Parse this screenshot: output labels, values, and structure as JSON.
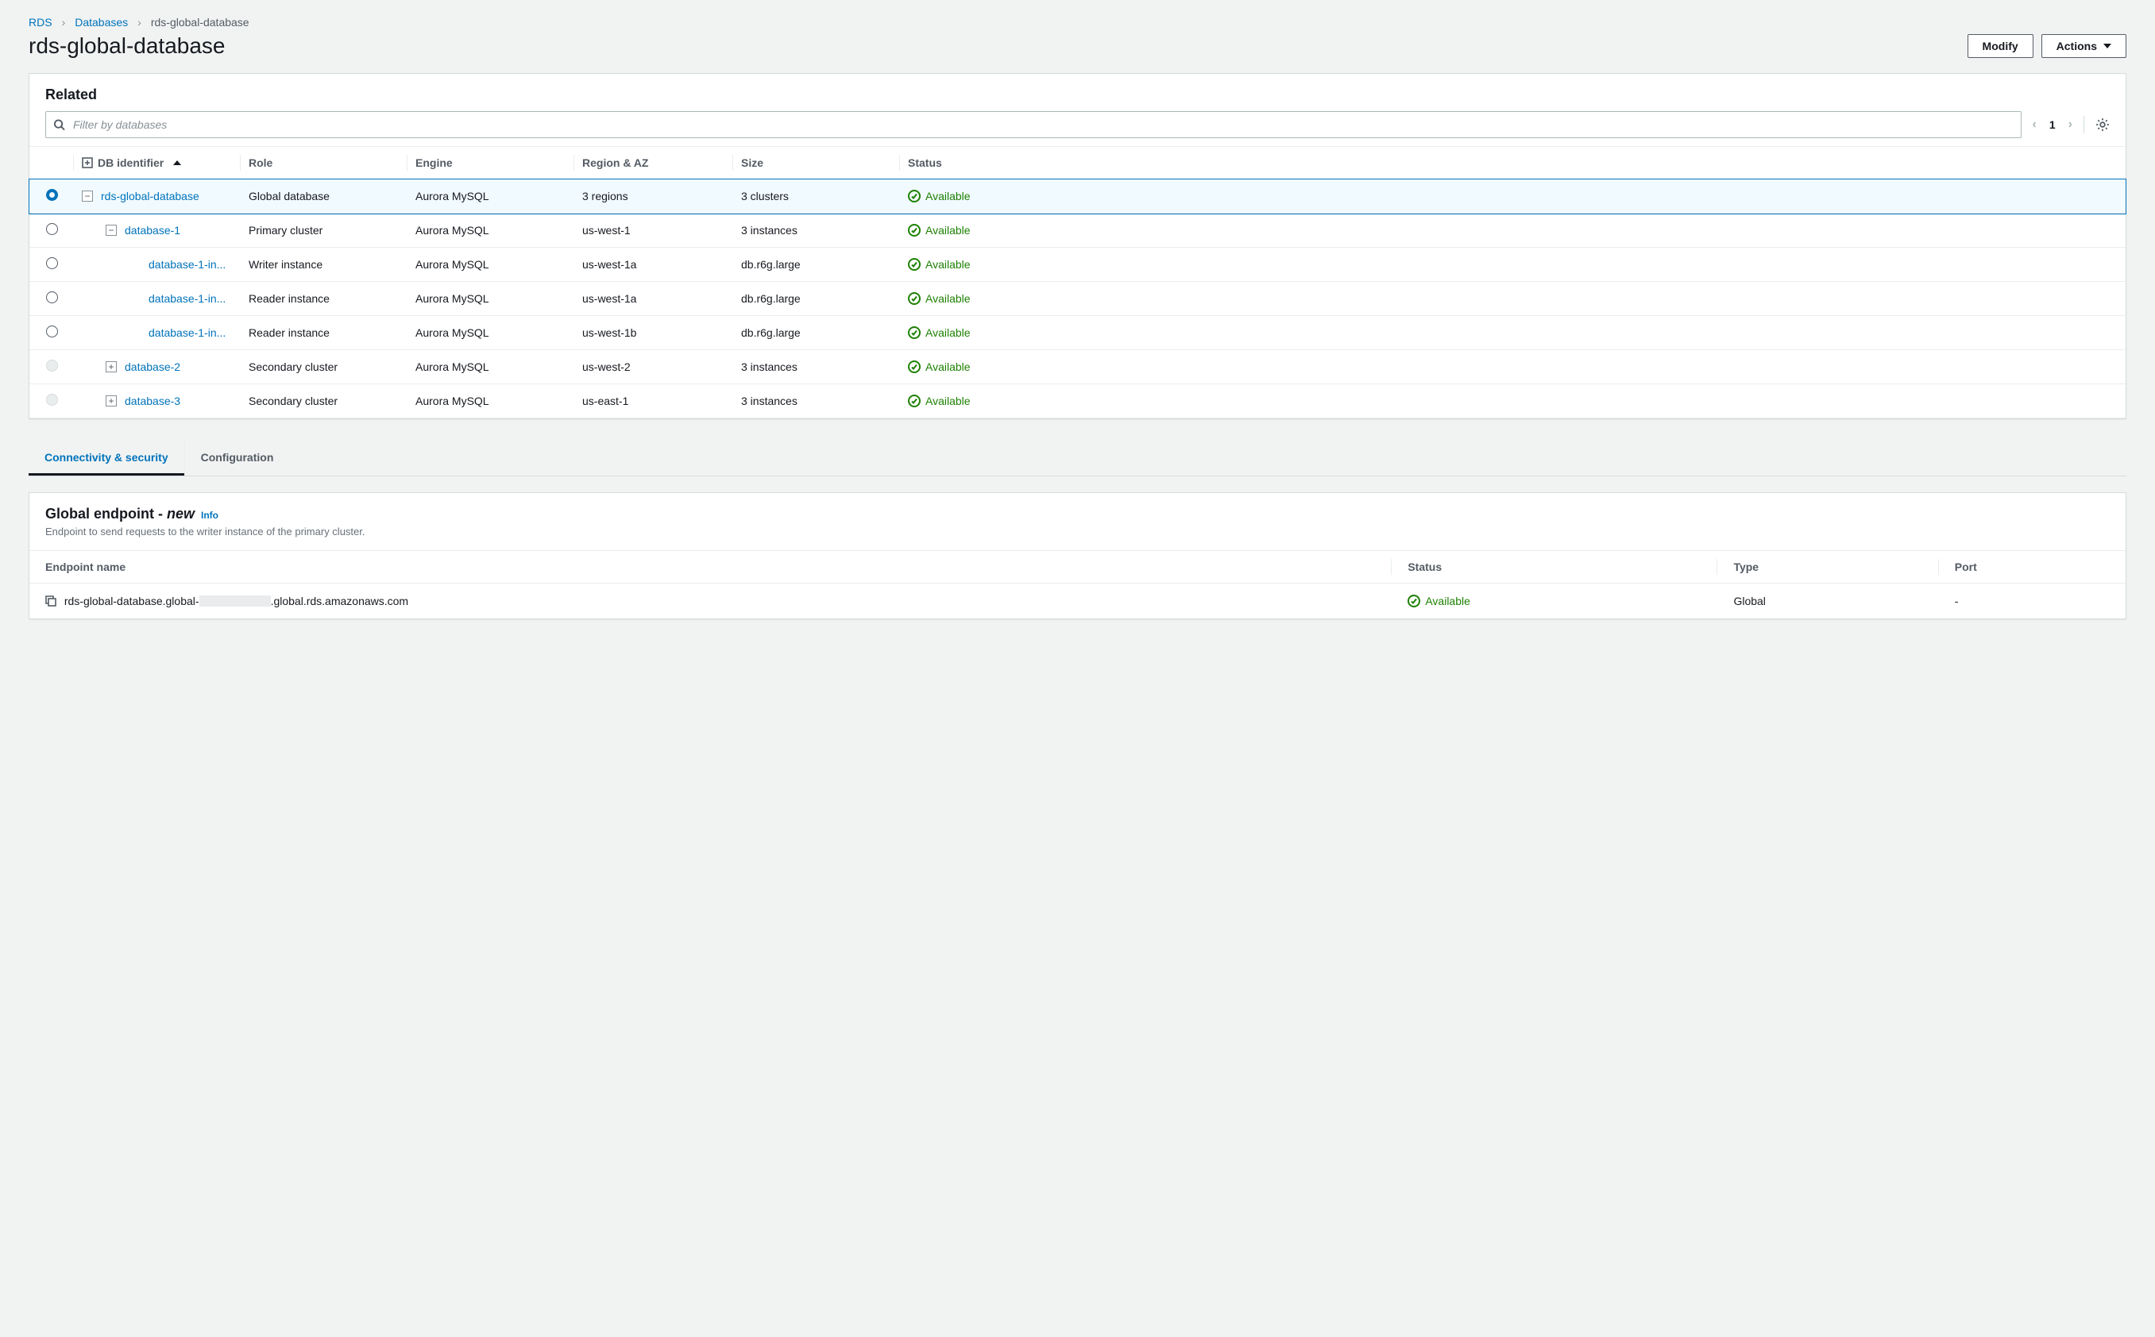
{
  "breadcrumbs": {
    "root": "RDS",
    "level1": "Databases",
    "current": "rds-global-database"
  },
  "page": {
    "title": "rds-global-database",
    "modify_label": "Modify",
    "actions_label": "Actions"
  },
  "related": {
    "title": "Related",
    "filter_placeholder": "Filter by databases",
    "page_number": "1",
    "columns": {
      "db_identifier": "DB identifier",
      "role": "Role",
      "engine": "Engine",
      "region_az": "Region & AZ",
      "size": "Size",
      "status": "Status"
    },
    "rows": [
      {
        "id_display": "rds-global-database",
        "role": "Global database",
        "engine": "Aurora MySQL",
        "region": "3 regions",
        "size": "3 clusters",
        "status": "Available",
        "selected": true,
        "radio": "checked",
        "indent": 0,
        "expander": "minus"
      },
      {
        "id_display": "database-1",
        "role": "Primary cluster",
        "engine": "Aurora MySQL",
        "region": "us-west-1",
        "size": "3 instances",
        "status": "Available",
        "selected": false,
        "radio": "enabled",
        "indent": 1,
        "expander": "minus"
      },
      {
        "id_display": "database-1-in...",
        "role": "Writer instance",
        "engine": "Aurora MySQL",
        "region": "us-west-1a",
        "size": "db.r6g.large",
        "status": "Available",
        "selected": false,
        "radio": "enabled",
        "indent": 2,
        "expander": "none"
      },
      {
        "id_display": "database-1-in...",
        "role": "Reader instance",
        "engine": "Aurora MySQL",
        "region": "us-west-1a",
        "size": "db.r6g.large",
        "status": "Available",
        "selected": false,
        "radio": "enabled",
        "indent": 2,
        "expander": "none"
      },
      {
        "id_display": "database-1-in...",
        "role": "Reader instance",
        "engine": "Aurora MySQL",
        "region": "us-west-1b",
        "size": "db.r6g.large",
        "status": "Available",
        "selected": false,
        "radio": "enabled",
        "indent": 2,
        "expander": "none"
      },
      {
        "id_display": "database-2",
        "role": "Secondary cluster",
        "engine": "Aurora MySQL",
        "region": "us-west-2",
        "size": "3 instances",
        "status": "Available",
        "selected": false,
        "radio": "disabled",
        "indent": 1,
        "expander": "plus"
      },
      {
        "id_display": "database-3",
        "role": "Secondary cluster",
        "engine": "Aurora MySQL",
        "region": "us-east-1",
        "size": "3 instances",
        "status": "Available",
        "selected": false,
        "radio": "disabled",
        "indent": 1,
        "expander": "plus"
      }
    ]
  },
  "tabs": {
    "connectivity": "Connectivity & security",
    "configuration": "Configuration",
    "active": "connectivity"
  },
  "endpoint": {
    "title": "Global endpoint - ",
    "new_badge": "new",
    "info_label": "Info",
    "subtitle": "Endpoint to send requests to the writer instance of the primary cluster.",
    "columns": {
      "name": "Endpoint name",
      "status": "Status",
      "type": "Type",
      "port": "Port"
    },
    "row": {
      "name_prefix": "rds-global-database.global-",
      "name_suffix": ".global.rds.amazonaws.com",
      "status": "Available",
      "type": "Global",
      "port": "-"
    }
  }
}
